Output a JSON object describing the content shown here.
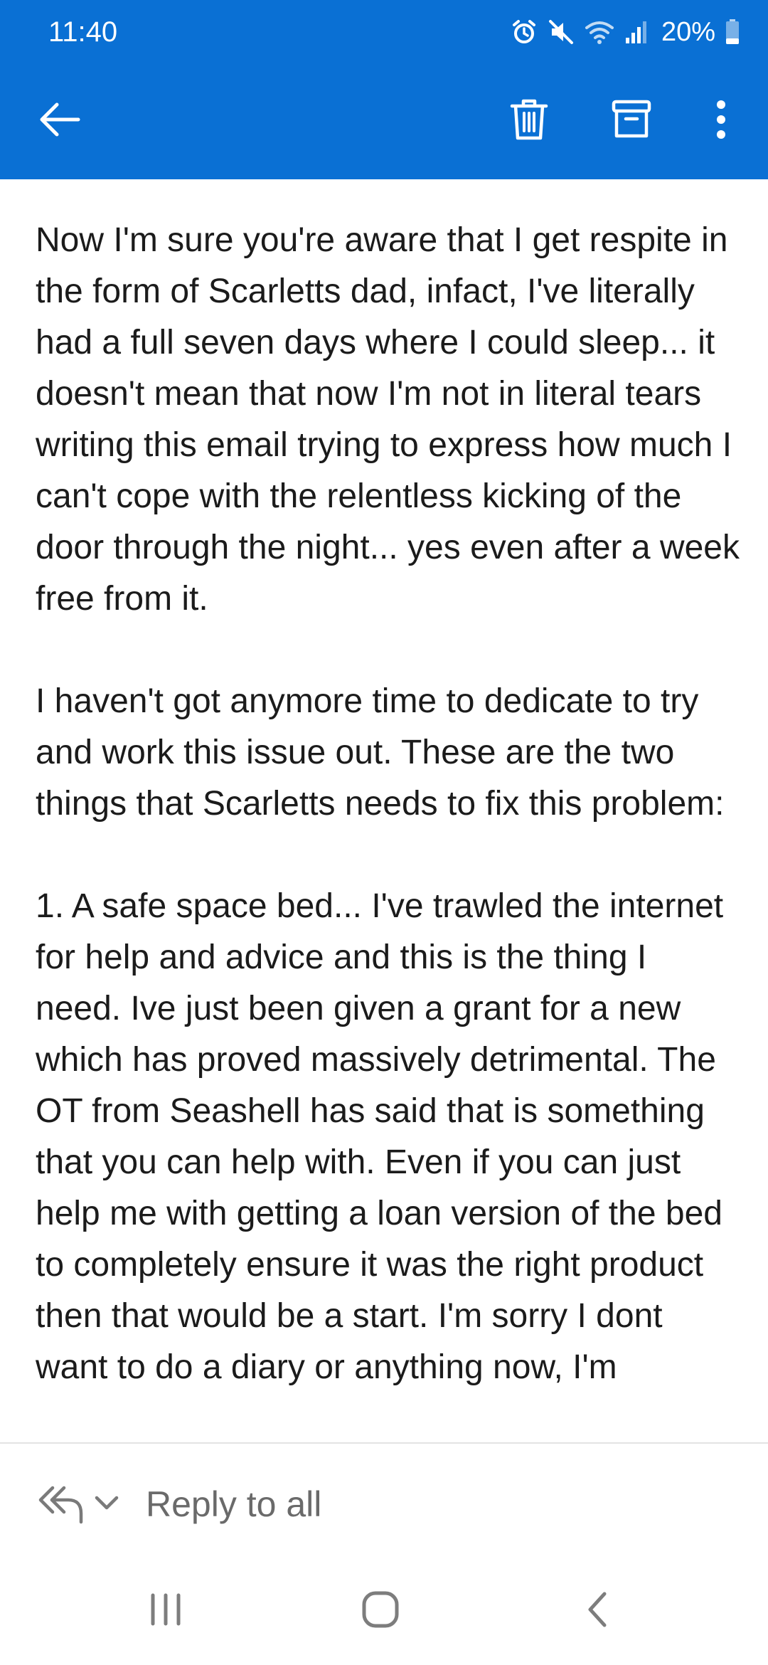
{
  "status_bar": {
    "time": "11:40",
    "battery_percent": "20%",
    "icons": [
      "alarm-icon",
      "mute-icon",
      "wifi-icon",
      "signal-icon",
      "battery-icon"
    ]
  },
  "app_bar": {
    "color": "#0a70d4",
    "icons": [
      "back-arrow-icon",
      "trash-icon",
      "archive-icon",
      "more-vertical-icon"
    ]
  },
  "email": {
    "paragraphs": [
      "Now I'm sure you're aware that I get respite in the form of Scarletts dad, infact, I've literally had a full seven days where I could sleep... it doesn't mean that now I'm not in literal tears writing this email trying to express how much I can't cope with the relentless kicking of the door through the night... yes even after a week free from it.",
      "I haven't got anymore time to dedicate to try and work this issue out. These are the two things that Scarletts needs to fix this problem:",
      "1. A safe space bed... I've trawled the internet for help and advice and this is the thing I need. Ive just been given a grant for a new which has proved massively detrimental. The OT from Seashell has said that is something that you can help with. Even if you can just help me with getting a loan version of the bed to completely ensure it was the right product then that would be a start. I'm sorry I dont want to do a diary or anything now, I'm"
    ]
  },
  "reply_bar": {
    "label": "Reply to all",
    "icons": [
      "reply-all-icon",
      "chevron-down-icon"
    ]
  },
  "nav_bar": {
    "icons": [
      "recents-icon",
      "home-icon",
      "back-icon"
    ]
  }
}
